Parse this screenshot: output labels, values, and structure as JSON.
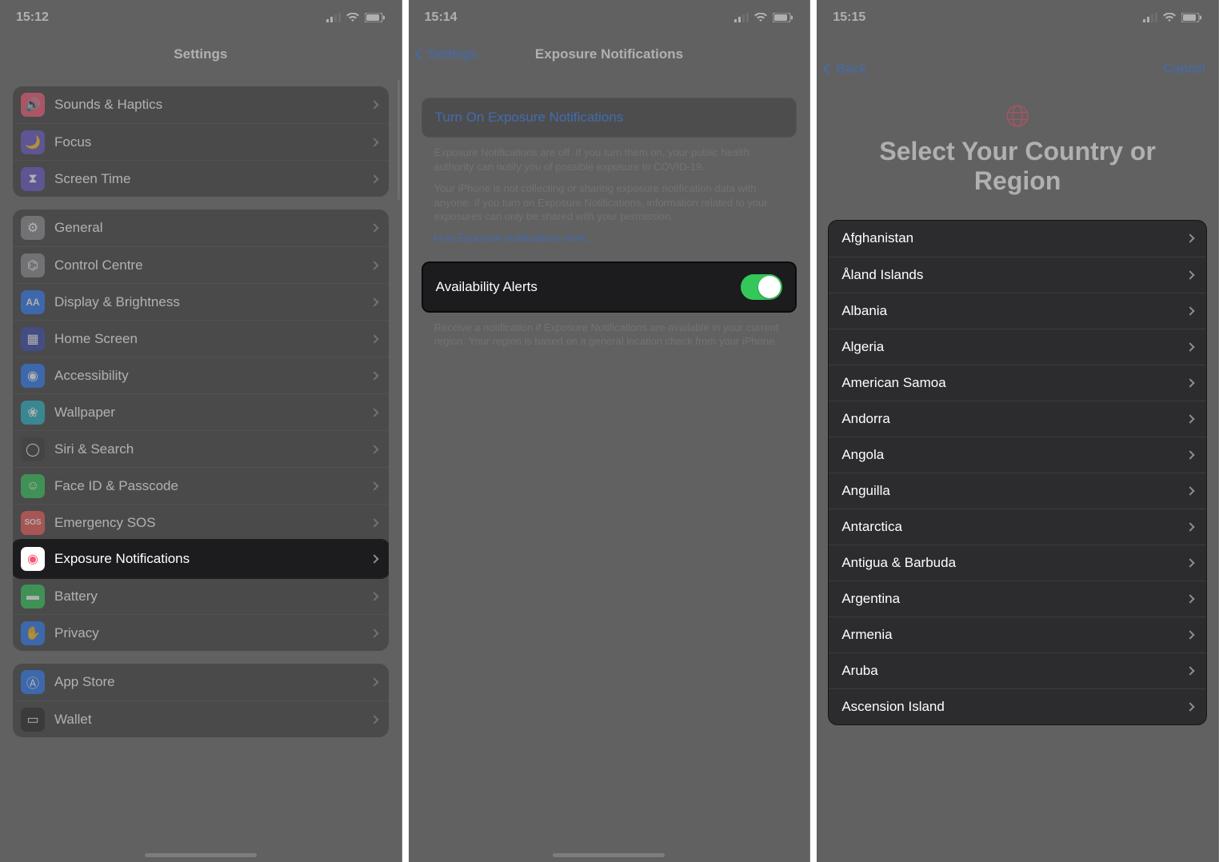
{
  "screen1": {
    "time": "15:12",
    "title": "Settings",
    "group1": [
      {
        "icon": "sounds-icon",
        "color": "#f25c78",
        "label": "Sounds & Haptics"
      },
      {
        "icon": "focus-icon",
        "color": "#6a5acd",
        "label": "Focus"
      },
      {
        "icon": "screentime-icon",
        "color": "#6a5acd",
        "label": "Screen Time"
      }
    ],
    "group2": [
      {
        "icon": "general-icon",
        "color": "#8e8e93",
        "label": "General"
      },
      {
        "icon": "control-icon",
        "color": "#8e8e93",
        "label": "Control Centre"
      },
      {
        "icon": "display-icon",
        "color": "#2f7cf6",
        "label": "Display & Brightness"
      },
      {
        "icon": "home-icon",
        "color": "#3a4bb0",
        "label": "Home Screen"
      },
      {
        "icon": "accessibility-icon",
        "color": "#2f7cf6",
        "label": "Accessibility"
      },
      {
        "icon": "wallpaper-icon",
        "color": "#27b7c6",
        "label": "Wallpaper"
      },
      {
        "icon": "siri-icon",
        "color": "#3b3b3b",
        "label": "Siri & Search"
      },
      {
        "icon": "faceid-icon",
        "color": "#34c759",
        "label": "Face ID & Passcode"
      },
      {
        "icon": "sos-icon",
        "color": "#f05a5a",
        "label": "Emergency SOS"
      },
      {
        "icon": "exposure-icon",
        "color": "#ffffff",
        "label": "Exposure Notifications",
        "highlight": true
      },
      {
        "icon": "battery-icon",
        "color": "#34c759",
        "label": "Battery"
      },
      {
        "icon": "privacy-icon",
        "color": "#2f7cf6",
        "label": "Privacy"
      }
    ],
    "group3": [
      {
        "icon": "appstore-icon",
        "color": "#2f7cf6",
        "label": "App Store"
      },
      {
        "icon": "wallet-icon",
        "color": "#2b2b2b",
        "label": "Wallet"
      }
    ]
  },
  "screen2": {
    "time": "15:14",
    "back": "Settings",
    "title": "Exposure Notifications",
    "turn_on": "Turn On Exposure Notifications",
    "help1": "Exposure Notifications are off. If you turn them on, your public health authority can notify you of possible exposure to COVID-19.",
    "help2": "Your iPhone is not collecting or sharing exposure notification data with anyone. If you turn on Exposure Notifications, information related to your exposures can only be shared with your permission.",
    "link": "How Exposure Notifications work…",
    "toggle_label": "Availability Alerts",
    "toggle_on": true,
    "help3": "Receive a notification if Exposure Notifications are available in your current region. Your region is based on a general location check from your iPhone."
  },
  "screen3": {
    "time": "15:15",
    "back": "Back",
    "cancel": "Cancel",
    "title": "Select Your Country or Region",
    "countries": [
      "Afghanistan",
      "Åland Islands",
      "Albania",
      "Algeria",
      "American Samoa",
      "Andorra",
      "Angola",
      "Anguilla",
      "Antarctica",
      "Antigua & Barbuda",
      "Argentina",
      "Armenia",
      "Aruba",
      "Ascension Island"
    ]
  }
}
